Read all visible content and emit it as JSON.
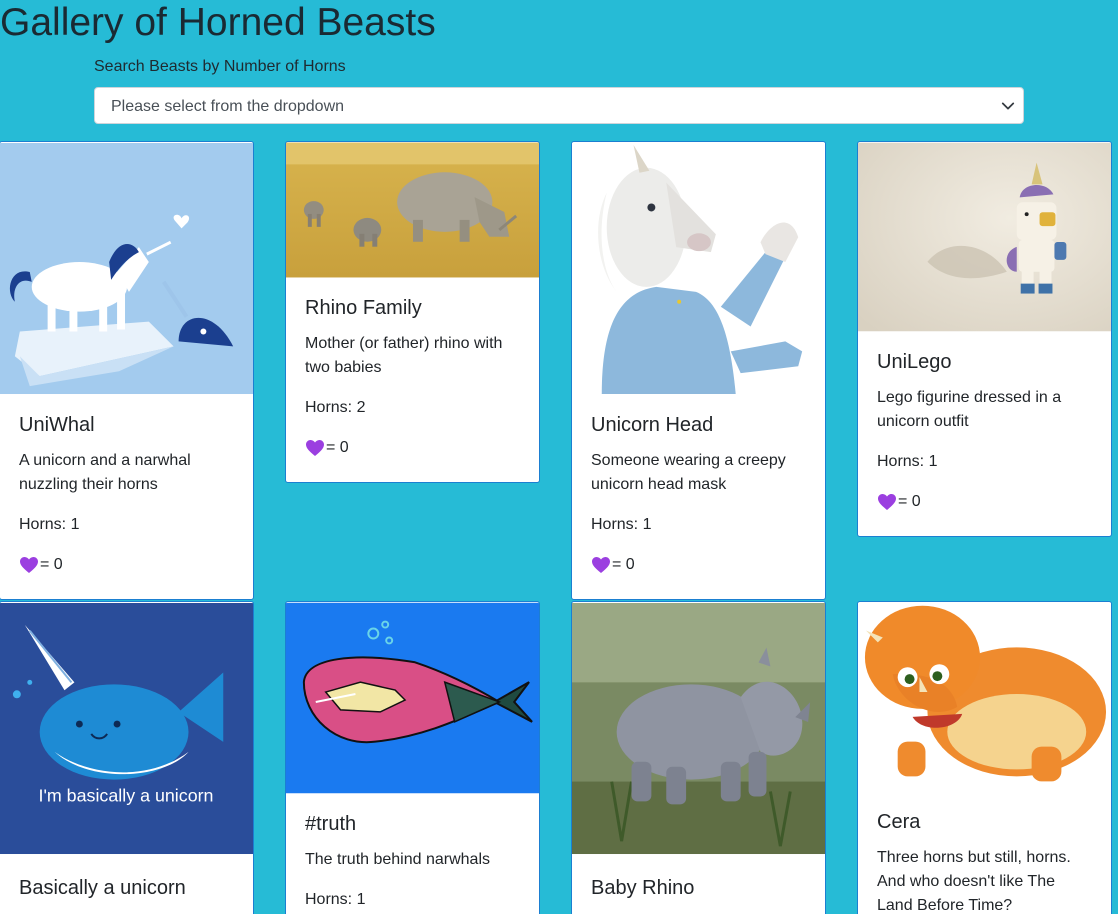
{
  "header": {
    "title": "Gallery of Horned Beasts"
  },
  "search": {
    "label": "Search Beasts by Number of Horns",
    "selected": "Please select from the dropdown"
  },
  "like_prefix": "= ",
  "cards": [
    {
      "title": "UniWhal",
      "description": "A unicorn and a narwhal nuzzling their horns",
      "horns": "Horns: 1",
      "likes": "0"
    },
    {
      "title": "Rhino Family",
      "description": "Mother (or father) rhino with two babies",
      "horns": "Horns: 2",
      "likes": "0"
    },
    {
      "title": "Unicorn Head",
      "description": "Someone wearing a creepy unicorn head mask",
      "horns": "Horns: 1",
      "likes": "0"
    },
    {
      "title": "UniLego",
      "description": "Lego figurine dressed in a unicorn outfit",
      "horns": "Horns: 1",
      "likes": "0"
    },
    {
      "title": "Basically a unicorn",
      "image_caption": "I'm basically a unicorn"
    },
    {
      "title": "#truth",
      "description": "The truth behind narwhals",
      "horns": "Horns: 1"
    },
    {
      "title": "Baby Rhino"
    },
    {
      "title": "Cera",
      "description": "Three horns but still, horns. And who doesn't like The Land Before Time?"
    }
  ],
  "colors": {
    "background": "#26bbd6",
    "card_border": "#1b7fd1",
    "heart": "#9b3fe0"
  }
}
